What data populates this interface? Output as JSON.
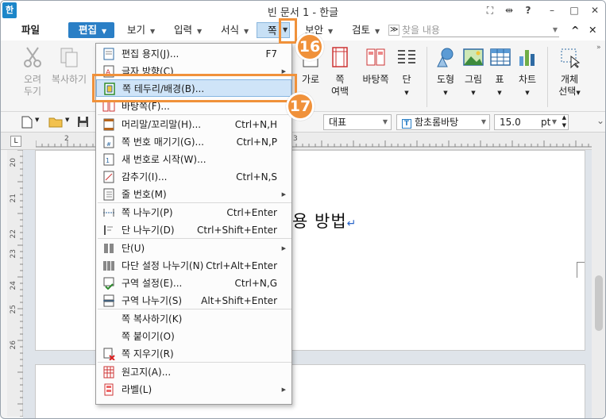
{
  "window": {
    "title": "빈 문서 1 - 한글",
    "app_icon": "한",
    "controls": [
      "⛶",
      "⇹",
      "?",
      "–",
      "□",
      "✕"
    ]
  },
  "menubar": {
    "items": [
      "파일",
      "편집",
      "보기",
      "입력",
      "서식",
      "쪽",
      "보안",
      "검토"
    ],
    "more": "≫",
    "search_placeholder": "찾을 내용",
    "search_up": "^",
    "search_close": "✕"
  },
  "ribbon": {
    "cut": [
      "오려",
      "두기"
    ],
    "copy": "복사하기",
    "landscape": "가로",
    "margin": [
      "쪽",
      "여백"
    ],
    "background": "바탕쪽",
    "column": "단",
    "shape": "도형",
    "picture": "그림",
    "table": "표",
    "chart": "차트",
    "object": [
      "개체",
      "선택"
    ]
  },
  "toolbar2": {
    "style": "대표",
    "font": "함초롬바탕",
    "font_size": "15.0",
    "unit": "pt"
  },
  "ruler": {
    "h_ticks": [
      "2",
      "3"
    ],
    "v_ticks": [
      "20",
      "21",
      "22",
      "23",
      "24",
      "25",
      "26"
    ]
  },
  "document": {
    "text": "용 방법"
  },
  "badges": {
    "b16": "16",
    "b17": "17"
  },
  "menu": {
    "items": [
      {
        "label": "편집 용지(J)...",
        "shortcut": "F7",
        "icon": "page-setup-icon"
      },
      {
        "label": "글자 방향(C)",
        "shortcut": "",
        "icon": "text-direction-icon",
        "sub": true
      },
      {
        "label": "쪽 테두리/배경(B)...",
        "shortcut": "",
        "icon": "page-border-icon",
        "selected": true
      },
      {
        "label": "바탕쪽(F)...",
        "shortcut": "",
        "icon": "master-page-icon"
      },
      {
        "label": "머리말/꼬리말(H)...",
        "shortcut": "Ctrl+N,H",
        "icon": "header-footer-icon"
      },
      {
        "label": "쪽 번호 매기기(G)...",
        "shortcut": "Ctrl+N,P",
        "icon": "page-number-icon"
      },
      {
        "label": "새 번호로 시작(W)...",
        "shortcut": "",
        "icon": "new-number-icon"
      },
      {
        "label": "감추기(I)...",
        "shortcut": "Ctrl+N,S",
        "icon": "hide-icon"
      },
      {
        "label": "줄 번호(M)",
        "shortcut": "",
        "icon": "line-number-icon",
        "sub": true
      },
      {
        "label": "쪽 나누기(P)",
        "shortcut": "Ctrl+Enter",
        "icon": "page-break-icon"
      },
      {
        "label": "단 나누기(D)",
        "shortcut": "Ctrl+Shift+Enter",
        "icon": "column-break-icon"
      },
      {
        "label": "단(U)",
        "shortcut": "",
        "icon": "column-icon",
        "sub": true
      },
      {
        "label": "다단 설정 나누기(N)",
        "shortcut": "Ctrl+Alt+Enter",
        "icon": "multicolumn-icon"
      },
      {
        "label": "구역 설정(E)...",
        "shortcut": "Ctrl+N,G",
        "icon": "section-setting-icon"
      },
      {
        "label": "구역 나누기(S)",
        "shortcut": "Alt+Shift+Enter",
        "icon": "section-break-icon"
      },
      {
        "label": "쪽 복사하기(K)",
        "shortcut": "",
        "icon": ""
      },
      {
        "label": "쪽 붙이기(O)",
        "shortcut": "",
        "icon": ""
      },
      {
        "label": "쪽 지우기(R)",
        "shortcut": "",
        "icon": "page-delete-icon"
      },
      {
        "label": "원고지(A)...",
        "shortcut": "",
        "icon": "manuscript-icon"
      },
      {
        "label": "라벨(L)",
        "shortcut": "",
        "icon": "label-icon",
        "sub": true
      }
    ]
  }
}
